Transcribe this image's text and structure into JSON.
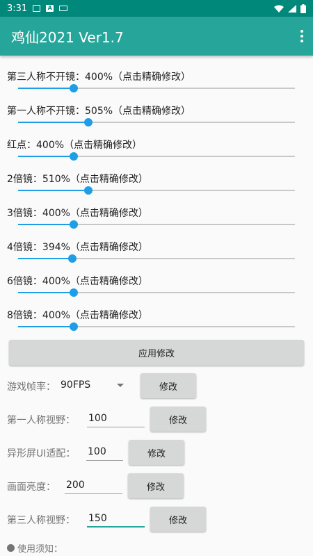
{
  "status_bar": {
    "time": "3:31"
  },
  "app_bar": {
    "title": "鸡仙2021 Ver1.7"
  },
  "sliders": [
    {
      "label": "第三人称不开镜：400%（点击精确修改）",
      "value_fraction": 0.2
    },
    {
      "label": "第一人称不开镜：505%（点击精确修改）",
      "value_fraction": 0.253
    },
    {
      "label": "红点：400%（点击精确修改）",
      "value_fraction": 0.2
    },
    {
      "label": "2倍镜：510%（点击精确修改）",
      "value_fraction": 0.255
    },
    {
      "label": "3倍镜：400%（点击精确修改）",
      "value_fraction": 0.2
    },
    {
      "label": "4倍镜：394%（点击精确修改）",
      "value_fraction": 0.197
    },
    {
      "label": "6倍镜：400%（点击精确修改）",
      "value_fraction": 0.2
    },
    {
      "label": "8倍镜：400%（点击精确修改）",
      "value_fraction": 0.2
    }
  ],
  "apply_button": "应用修改",
  "fps": {
    "label": "游戏帧率：",
    "value": "90FPS",
    "button": "修改"
  },
  "fov_first": {
    "label": "第一人称视野：",
    "value": "100",
    "button": "修改"
  },
  "notch_ui": {
    "label": "异形屏UI适配：",
    "value": "100",
    "button": "修改"
  },
  "brightness": {
    "label": "画面亮度：",
    "value": "200",
    "button": "修改"
  },
  "fov_third": {
    "label": "第三人称视野：",
    "value": "150",
    "button": "修改"
  },
  "notice": {
    "label": "使用须知："
  },
  "colors": {
    "status_bar": "#00897b",
    "app_bar": "#26a69a",
    "slider_accent": "#1e9ee6"
  }
}
